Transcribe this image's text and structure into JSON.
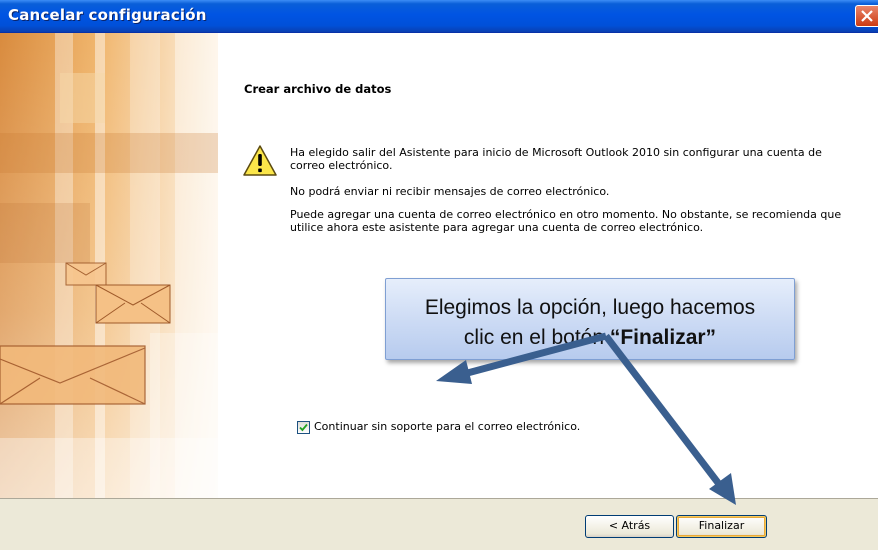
{
  "window": {
    "title": "Cancelar configuración"
  },
  "main": {
    "heading": "Crear archivo de datos",
    "icon": "warning-icon",
    "message_1": "Ha elegido salir del Asistente para inicio de Microsoft Outlook 2010 sin configurar una cuenta de correo electrónico.",
    "message_2": "No podrá enviar ni recibir mensajes de correo electrónico.",
    "message_3": "Puede agregar una cuenta de correo electrónico en otro momento. No obstante, se recomienda que utilice ahora este asistente para agregar una cuenta de correo electrónico.",
    "checkbox_label": "Continuar sin soporte para el correo electrónico.",
    "checkbox_checked": true
  },
  "callout": {
    "line_1": "Elegimos la opción, luego hacemos",
    "line_2_prefix": "clic en el botón ",
    "line_2_bold": "“Finalizar”"
  },
  "footer": {
    "back_label": "< Atrás",
    "finish_label": "Finalizar"
  },
  "colors": {
    "titlebar": "#0054e3",
    "callout_fill": "#cbdaf4",
    "arrow": "#3a5f8f",
    "art_orange": "#e8a55a"
  }
}
